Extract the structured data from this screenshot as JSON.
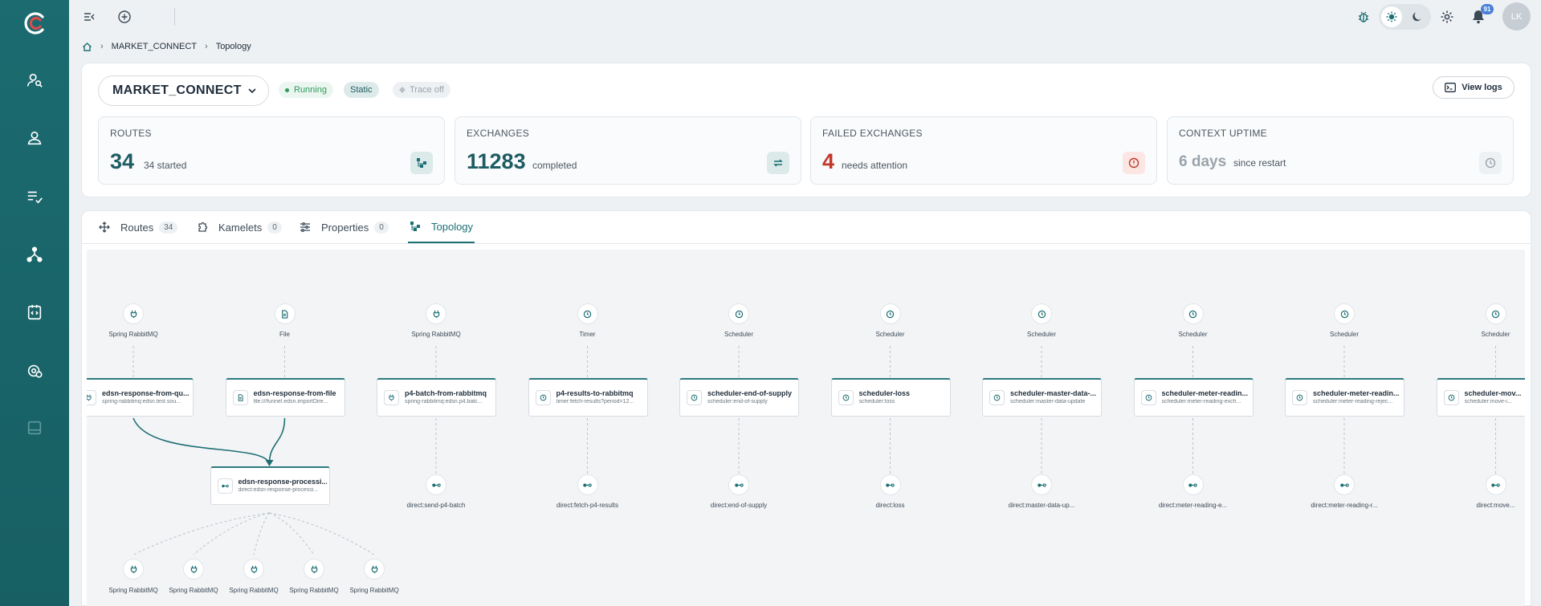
{
  "app": {
    "logo": "camel-logo"
  },
  "sidebar": {
    "items": [
      {
        "icon": "user-search-icon"
      },
      {
        "icon": "user-icon"
      },
      {
        "icon": "checklist-icon"
      },
      {
        "icon": "topology-icon"
      },
      {
        "icon": "code-document-icon"
      },
      {
        "icon": "gear-badge-icon"
      },
      {
        "icon": "panel-icon"
      }
    ]
  },
  "topbar": {
    "notifications_count": "91",
    "avatar_initials": "LK"
  },
  "breadcrumb": {
    "items": [
      "MARKET_CONNECT",
      "Topology"
    ]
  },
  "context": {
    "name": "MARKET_CONNECT",
    "status_running": "Running",
    "status_static": "Static",
    "status_trace": "Trace off",
    "view_logs": "View logs"
  },
  "stats": [
    {
      "label": "ROUTES",
      "value": "34",
      "sub": "34 started",
      "color": "#1d5c63"
    },
    {
      "label": "EXCHANGES",
      "value": "11283",
      "sub": "completed",
      "color": "#1d5c63"
    },
    {
      "label": "FAILED EXCHANGES",
      "value": "4",
      "sub": "needs attention",
      "color": "#c0392b"
    },
    {
      "label": "CONTEXT UPTIME",
      "value": "6 days",
      "sub": "since restart",
      "color": "#9aa3ab"
    }
  ],
  "tabs": [
    {
      "label": "Routes",
      "count": "34"
    },
    {
      "label": "Kamelets",
      "count": "0"
    },
    {
      "label": "Properties",
      "count": "0"
    },
    {
      "label": "Topology",
      "count": ""
    }
  ],
  "topology": {
    "sources": [
      {
        "label": "Spring RabbitMQ",
        "icon": "plug-icon"
      },
      {
        "label": "File",
        "icon": "file-icon"
      },
      {
        "label": "Spring RabbitMQ",
        "icon": "plug-icon"
      },
      {
        "label": "Timer",
        "icon": "clock-icon"
      },
      {
        "label": "Scheduler",
        "icon": "clock-icon"
      },
      {
        "label": "Scheduler",
        "icon": "clock-icon"
      },
      {
        "label": "Scheduler",
        "icon": "clock-icon"
      },
      {
        "label": "Scheduler",
        "icon": "clock-icon"
      },
      {
        "label": "Scheduler",
        "icon": "clock-icon"
      },
      {
        "label": "Scheduler",
        "icon": "clock-icon"
      }
    ],
    "routes": [
      {
        "name": "edsn-response-from-qu...",
        "uri": "spring-rabbitmq:edsn.test.sou..."
      },
      {
        "name": "edsn-response-from-file",
        "uri": "file:///funnel.edsn.importDire..."
      },
      {
        "name": "p4-batch-from-rabbitmq",
        "uri": "spring-rabbitmq:edsn.p4.batc..."
      },
      {
        "name": "p4-results-to-rabbitmq",
        "uri": "timer:fetch-results?period=12..."
      },
      {
        "name": "scheduler-end-of-supply",
        "uri": "scheduler:end-of-supply"
      },
      {
        "name": "scheduler-loss",
        "uri": "scheduler:loss"
      },
      {
        "name": "scheduler-master-data-...",
        "uri": "scheduler:master-data-update"
      },
      {
        "name": "scheduler-meter-readin...",
        "uri": "scheduler:meter-reading-exch..."
      },
      {
        "name": "scheduler-meter-readin...",
        "uri": "scheduler:meter-reading-rejec..."
      },
      {
        "name": "scheduler-mov...",
        "uri": "scheduler:move-i..."
      }
    ],
    "targets": [
      {
        "label": "direct:send-p4-batch"
      },
      {
        "label": "direct:fetch-p4-results"
      },
      {
        "label": "direct:end-of-supply"
      },
      {
        "label": "direct:loss"
      },
      {
        "label": "direct:master-data-up..."
      },
      {
        "label": "direct:meter-reading-e..."
      },
      {
        "label": "direct:meter-reading-r..."
      },
      {
        "label": "direct:move..."
      }
    ],
    "shared_route": {
      "name": "edsn-response-processi...",
      "uri": "direct:edsn-response-processi..."
    },
    "shared_outputs": [
      {
        "label": "Spring RabbitMQ"
      },
      {
        "label": "Spring RabbitMQ"
      },
      {
        "label": "Spring RabbitMQ"
      },
      {
        "label": "Spring RabbitMQ"
      },
      {
        "label": "Spring RabbitMQ"
      }
    ]
  }
}
